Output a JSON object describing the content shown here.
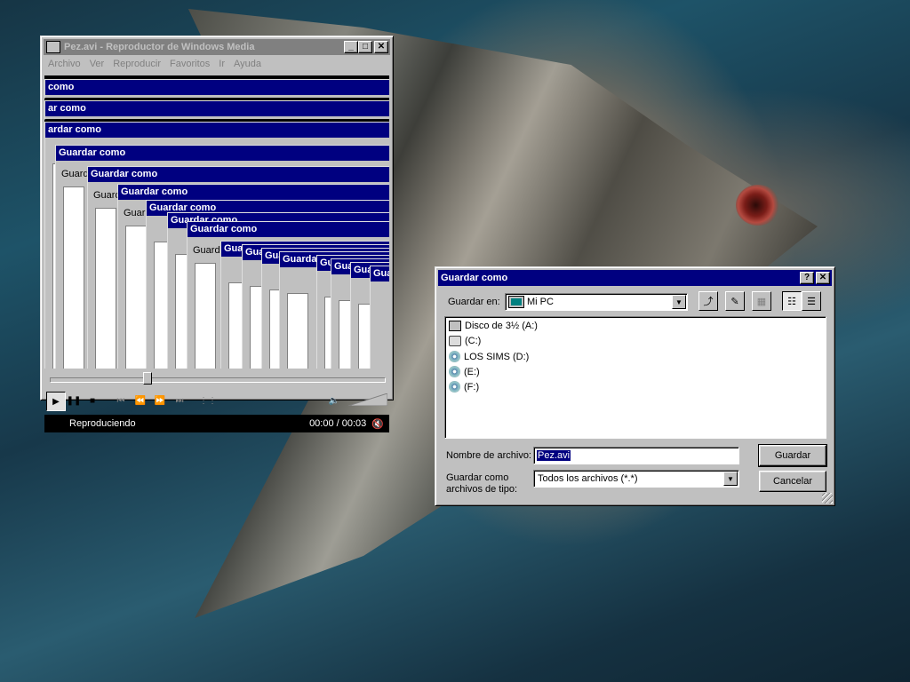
{
  "player": {
    "title": "Pez.avi - Reproductor de Windows Media",
    "menu": [
      "Archivo",
      "Ver",
      "Reproducir",
      "Favoritos",
      "Ir",
      "Ayuda"
    ],
    "ghost_title": "Guardar como",
    "ghost_title_cut1": "como",
    "ghost_title_cut2": "ar como",
    "ghost_title_cut3": "ardar como",
    "ghost_body": "Guardar en:",
    "status": "Reproduciendo",
    "time": "00:00 / 00:03",
    "seek_position": 0.29
  },
  "dialog": {
    "title": "Guardar como",
    "save_in_label": "Guardar en:",
    "save_in_value": "Mi PC",
    "items": [
      {
        "icon": "floppy-drive-icon",
        "label": "Disco de 3½ (A:)"
      },
      {
        "icon": "hard-drive-icon",
        "label": "(C:)"
      },
      {
        "icon": "cd-drive-icon",
        "label": "LOS SIMS (D:)"
      },
      {
        "icon": "cd-drive-icon",
        "label": "(E:)"
      },
      {
        "icon": "cd-drive-icon",
        "label": "(F:)"
      }
    ],
    "filename_label": "Nombre de archivo:",
    "filename_value": "Pez.avi",
    "filetype_label_1": "Guardar como",
    "filetype_label_2": "archivos de tipo:",
    "filetype_value": "Todos los archivos (*.*)",
    "save_button": "Guardar",
    "cancel_button": "Cancelar"
  },
  "colors": {
    "titlebar_active": "#000080",
    "window_face": "#c0c0c0"
  }
}
